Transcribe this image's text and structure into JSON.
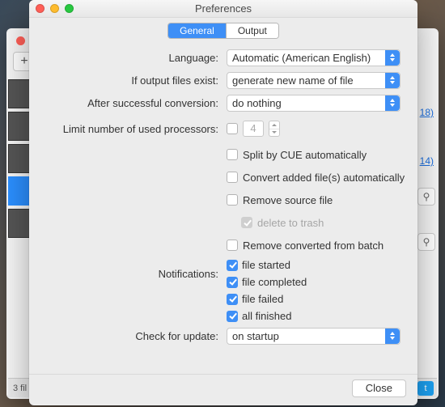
{
  "window": {
    "title": "Preferences"
  },
  "tabs": {
    "general": "General",
    "output": "Output"
  },
  "labels": {
    "language": "Language:",
    "ifExist": "If output files exist:",
    "afterConv": "After successful conversion:",
    "limitProc": "Limit number of used processors:",
    "notifications": "Notifications:",
    "checkUpdate": "Check for update:"
  },
  "values": {
    "language": "Automatic (American English)",
    "ifExist": "generate new name of file",
    "afterConv": "do nothing",
    "procCount": "4",
    "checkUpdate": "on startup"
  },
  "checks": {
    "splitCue": "Split by CUE automatically",
    "convertAuto": "Convert added file(s) automatically",
    "removeSrc": "Remove source file",
    "deleteTrash": "delete to trash",
    "removeBatch": "Remove converted from batch",
    "fileStarted": "file started",
    "fileCompleted": "file completed",
    "fileFailed": "file failed",
    "allFinished": "all finished"
  },
  "buttons": {
    "close": "Close"
  },
  "bg": {
    "link1": "18)",
    "link2": "14)",
    "plus": "+",
    "files": "3 fil",
    "tw": "t"
  }
}
